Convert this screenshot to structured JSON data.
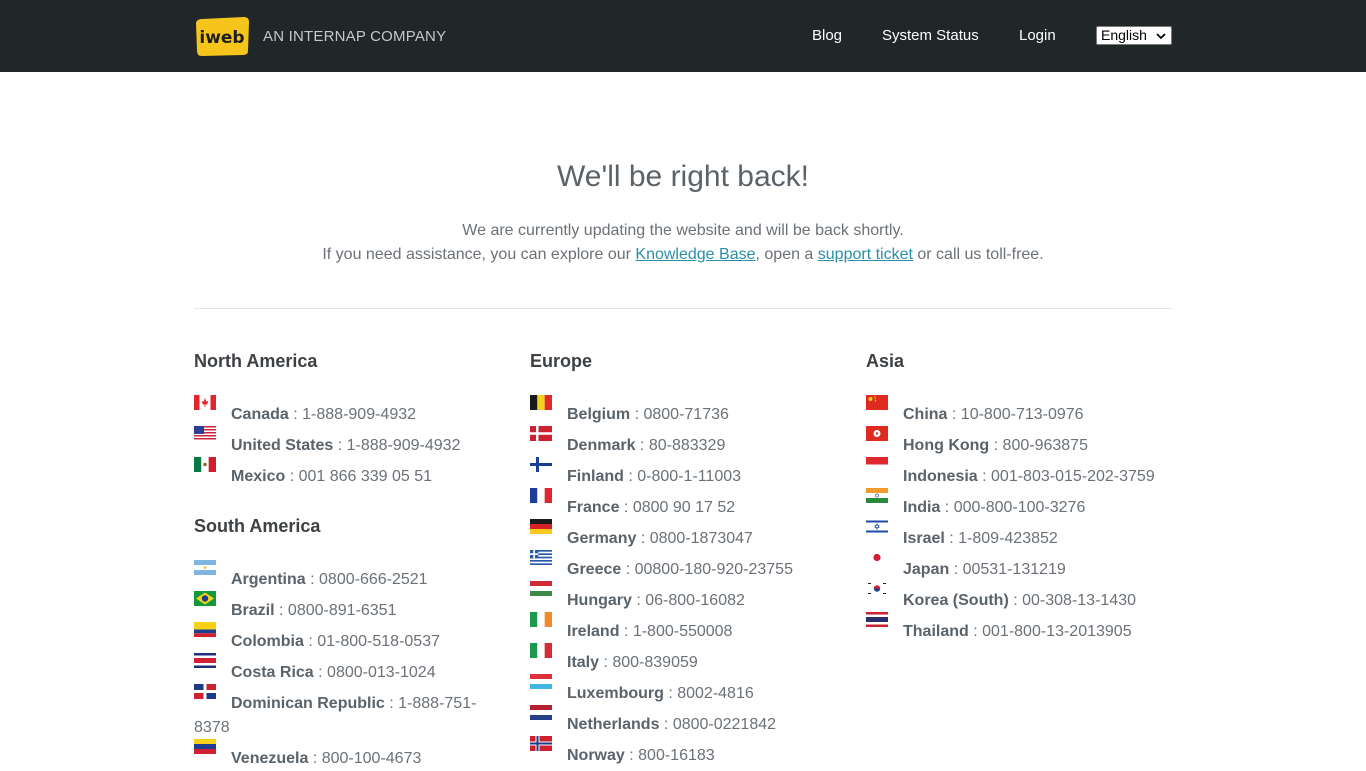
{
  "header": {
    "logo_text": "iweb",
    "tagline": "AN INTERNAP COMPANY",
    "nav": [
      "Blog",
      "System Status",
      "Login"
    ],
    "language": "English"
  },
  "main": {
    "title": "We'll be right back!",
    "line1": "We are currently updating the website and will be back shortly.",
    "line2_pre": "If you need assistance, you can explore our ",
    "kb_link": "Knowledge Base",
    "line2_mid": ", open a ",
    "ticket_link": "support ticket",
    "line2_post": " or call us toll-free."
  },
  "regions": {
    "north_america": {
      "title": "North America",
      "entries": [
        {
          "country": "Canada",
          "phone": "1-888-909-4932"
        },
        {
          "country": "United States",
          "phone": "1-888-909-4932"
        },
        {
          "country": "Mexico",
          "phone": "001 866 339 05 51"
        }
      ]
    },
    "south_america": {
      "title": "South America",
      "entries": [
        {
          "country": "Argentina",
          "phone": "0800-666-2521"
        },
        {
          "country": "Brazil",
          "phone": "0800-891-6351"
        },
        {
          "country": "Colombia",
          "phone": "01-800-518-0537"
        },
        {
          "country": "Costa Rica",
          "phone": "0800-013-1024"
        },
        {
          "country": "Dominican Republic",
          "phone": "1-888-751-8378"
        },
        {
          "country": "Venezuela",
          "phone": "800-100-4673"
        }
      ]
    },
    "europe": {
      "title": "Europe",
      "entries": [
        {
          "country": "Belgium",
          "phone": "0800-71736"
        },
        {
          "country": "Denmark",
          "phone": "80-883329"
        },
        {
          "country": "Finland",
          "phone": "0-800-1-11003"
        },
        {
          "country": "France",
          "phone": "0800 90 17 52"
        },
        {
          "country": "Germany",
          "phone": "0800-1873047"
        },
        {
          "country": "Greece",
          "phone": "00800-180-920-23755"
        },
        {
          "country": "Hungary",
          "phone": "06-800-16082"
        },
        {
          "country": "Ireland",
          "phone": "1-800-550008"
        },
        {
          "country": "Italy",
          "phone": "800-839059"
        },
        {
          "country": "Luxembourg",
          "phone": "8002-4816"
        },
        {
          "country": "Netherlands",
          "phone": "0800-0221842"
        },
        {
          "country": "Norway",
          "phone": "800-16183"
        }
      ]
    },
    "asia": {
      "title": "Asia",
      "entries": [
        {
          "country": "China",
          "phone": "10-800-713-0976"
        },
        {
          "country": "Hong Kong",
          "phone": "800-963875"
        },
        {
          "country": "Indonesia",
          "phone": "001-803-015-202-3759"
        },
        {
          "country": "India",
          "phone": "000-800-100-3276"
        },
        {
          "country": "Israel",
          "phone": "1-809-423852"
        },
        {
          "country": "Japan",
          "phone": "00531-131219"
        },
        {
          "country": "Korea (South)",
          "phone": "00-308-13-1430"
        },
        {
          "country": "Thailand",
          "phone": "001-800-13-2013905"
        }
      ]
    }
  },
  "colors": {
    "topbar": "#212629",
    "logo_yellow": "#f6c51b",
    "link": "#2a8fa8"
  }
}
